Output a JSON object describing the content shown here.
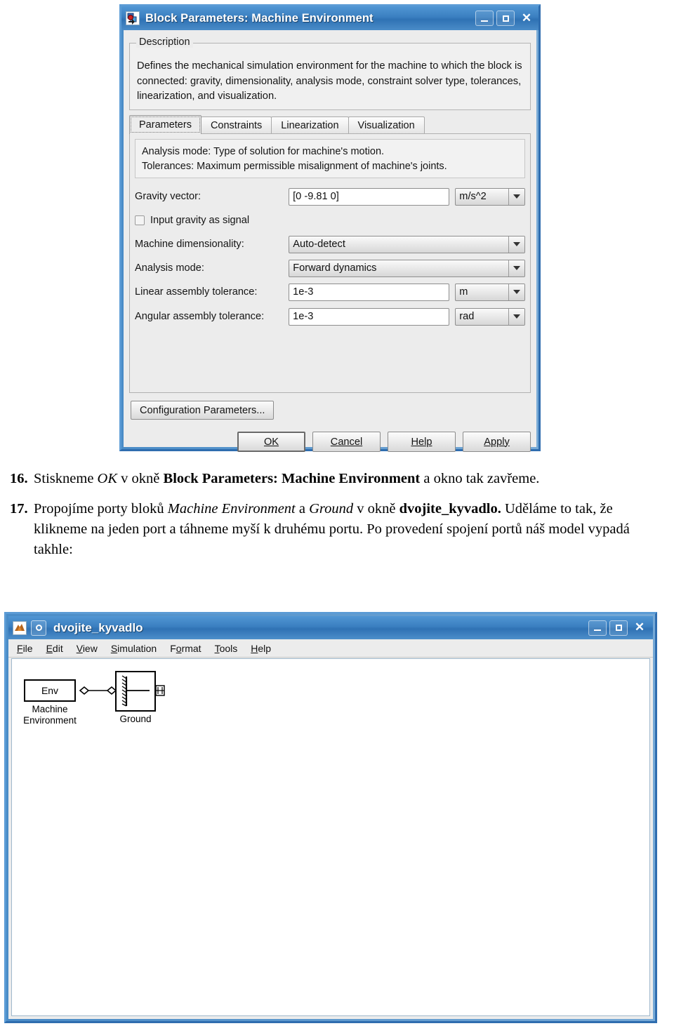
{
  "dialog": {
    "title": "Block Parameters: Machine Environment",
    "app_icon": "simulink-block-icon",
    "window_buttons": {
      "minimize": "minimize-icon",
      "maximize": "maximize-icon",
      "close": "close-icon"
    },
    "description": {
      "legend": "Description",
      "text": "Defines the mechanical simulation environment for the machine to which the block is connected: gravity, dimensionality, analysis mode, constraint solver type, tolerances, linearization, and visualization."
    },
    "tabs": [
      {
        "label": "Parameters",
        "selected": true
      },
      {
        "label": "Constraints",
        "selected": false
      },
      {
        "label": "Linearization",
        "selected": false
      },
      {
        "label": "Visualization",
        "selected": false
      }
    ],
    "hint": {
      "line1": "Analysis mode: Type of solution for machine's motion.",
      "line2": "Tolerances: Maximum permissible misalignment of machine's joints."
    },
    "fields": {
      "gravity_vector": {
        "label": "Gravity vector:",
        "value": "[0 -9.81 0]",
        "unit": "m/s^2"
      },
      "input_gravity_signal": {
        "label": "Input gravity as signal",
        "checked": false
      },
      "machine_dimensionality": {
        "label": "Machine dimensionality:",
        "value": "Auto-detect"
      },
      "analysis_mode": {
        "label": "Analysis mode:",
        "value": "Forward dynamics"
      },
      "linear_assembly_tolerance": {
        "label": "Linear assembly tolerance:",
        "value": "1e-3",
        "unit": "m"
      },
      "angular_assembly_tolerance": {
        "label": "Angular assembly tolerance:",
        "value": "1e-3",
        "unit": "rad"
      }
    },
    "config_button": "Configuration Parameters...",
    "buttons": {
      "ok": "OK",
      "cancel": "Cancel",
      "help": "Help",
      "apply": "Apply"
    }
  },
  "instructions": [
    {
      "number": "16.",
      "parts": [
        {
          "text": "Stiskneme ",
          "style": "normal"
        },
        {
          "text": "OK",
          "style": "italic"
        },
        {
          "text": " v okně ",
          "style": "normal"
        },
        {
          "text": "Block Parameters: Machine Environment",
          "style": "bold"
        },
        {
          "text": " a okno tak zavřeme.",
          "style": "normal"
        }
      ]
    },
    {
      "number": "17.",
      "parts": [
        {
          "text": "Propojíme porty bloků ",
          "style": "normal"
        },
        {
          "text": "Machine Environment",
          "style": "italic"
        },
        {
          "text": " a ",
          "style": "normal"
        },
        {
          "text": "Ground",
          "style": "italic"
        },
        {
          "text": " v okně ",
          "style": "normal"
        },
        {
          "text": "dvojite_kyvadlo.",
          "style": "bold"
        },
        {
          "text": " Uděláme to tak, že klikneme na jeden port a táhneme myší k druhému portu. Po provedení spojení portů náš model vypadá takhle:",
          "style": "normal"
        }
      ]
    }
  ],
  "simulink": {
    "title": "dvojite_kyvadlo",
    "app_icon": "matlab-membrane-icon",
    "doc_icon": "model-document-icon",
    "window_buttons": {
      "minimize": "minimize-icon",
      "maximize": "maximize-icon",
      "close": "close-icon"
    },
    "menus": [
      "File",
      "Edit",
      "View",
      "Simulation",
      "Format",
      "Tools",
      "Help"
    ],
    "menu_mnemonics": [
      "F",
      "E",
      "V",
      "S",
      "F",
      "T",
      "H"
    ],
    "blocks": [
      {
        "name": "Machine Environment",
        "inner_label": "Env",
        "caption_line1": "Machine",
        "caption_line2": "Environment"
      },
      {
        "name": "Ground",
        "inner_label": "",
        "caption_line1": "Ground",
        "caption_line2": ""
      }
    ],
    "connection": "env-port-to-ground-port"
  }
}
